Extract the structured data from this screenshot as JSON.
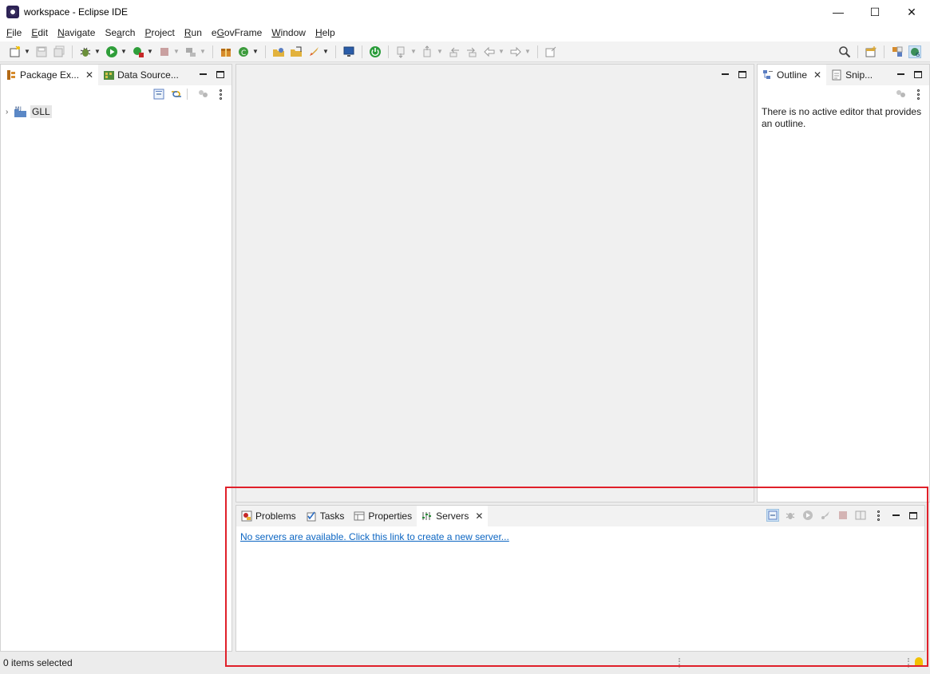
{
  "window": {
    "title": "workspace - Eclipse IDE",
    "controls": {
      "minimize": "—",
      "maximize": "☐",
      "close": "✕"
    }
  },
  "menubar": {
    "items": [
      {
        "prefix": "",
        "accel": "F",
        "rest": "ile"
      },
      {
        "prefix": "",
        "accel": "E",
        "rest": "dit"
      },
      {
        "prefix": "",
        "accel": "N",
        "rest": "avigate"
      },
      {
        "prefix": "Se",
        "accel": "a",
        "rest": "rch"
      },
      {
        "prefix": "",
        "accel": "P",
        "rest": "roject"
      },
      {
        "prefix": "",
        "accel": "R",
        "rest": "un"
      },
      {
        "prefix": "e",
        "accel": "G",
        "rest": "ovFrame"
      },
      {
        "prefix": "",
        "accel": "W",
        "rest": "indow"
      },
      {
        "prefix": "",
        "accel": "H",
        "rest": "elp"
      }
    ]
  },
  "left_panel": {
    "tabs": [
      {
        "label": "Package Ex...",
        "icon": "package-explorer-icon"
      },
      {
        "label": "Data Source...",
        "icon": "data-source-icon"
      }
    ],
    "tree": [
      {
        "label": "GLL",
        "icon": "project-icon"
      }
    ]
  },
  "right_panel": {
    "tabs": [
      {
        "label": "Outline",
        "icon": "outline-icon"
      },
      {
        "label": "Snip...",
        "icon": "snippets-icon"
      }
    ],
    "message": "There is no active editor that provides an outline."
  },
  "bottom_panel": {
    "tabs": [
      {
        "label": "Problems",
        "icon": "problems-icon"
      },
      {
        "label": "Tasks",
        "icon": "tasks-icon"
      },
      {
        "label": "Properties",
        "icon": "properties-icon"
      },
      {
        "label": "Servers",
        "icon": "servers-icon"
      }
    ],
    "servers_link": "No servers are available. Click this link to create a new server..."
  },
  "statusbar": {
    "text": "0 items selected"
  },
  "colors": {
    "highlight": "#e0202a",
    "link": "#0b65c2"
  }
}
